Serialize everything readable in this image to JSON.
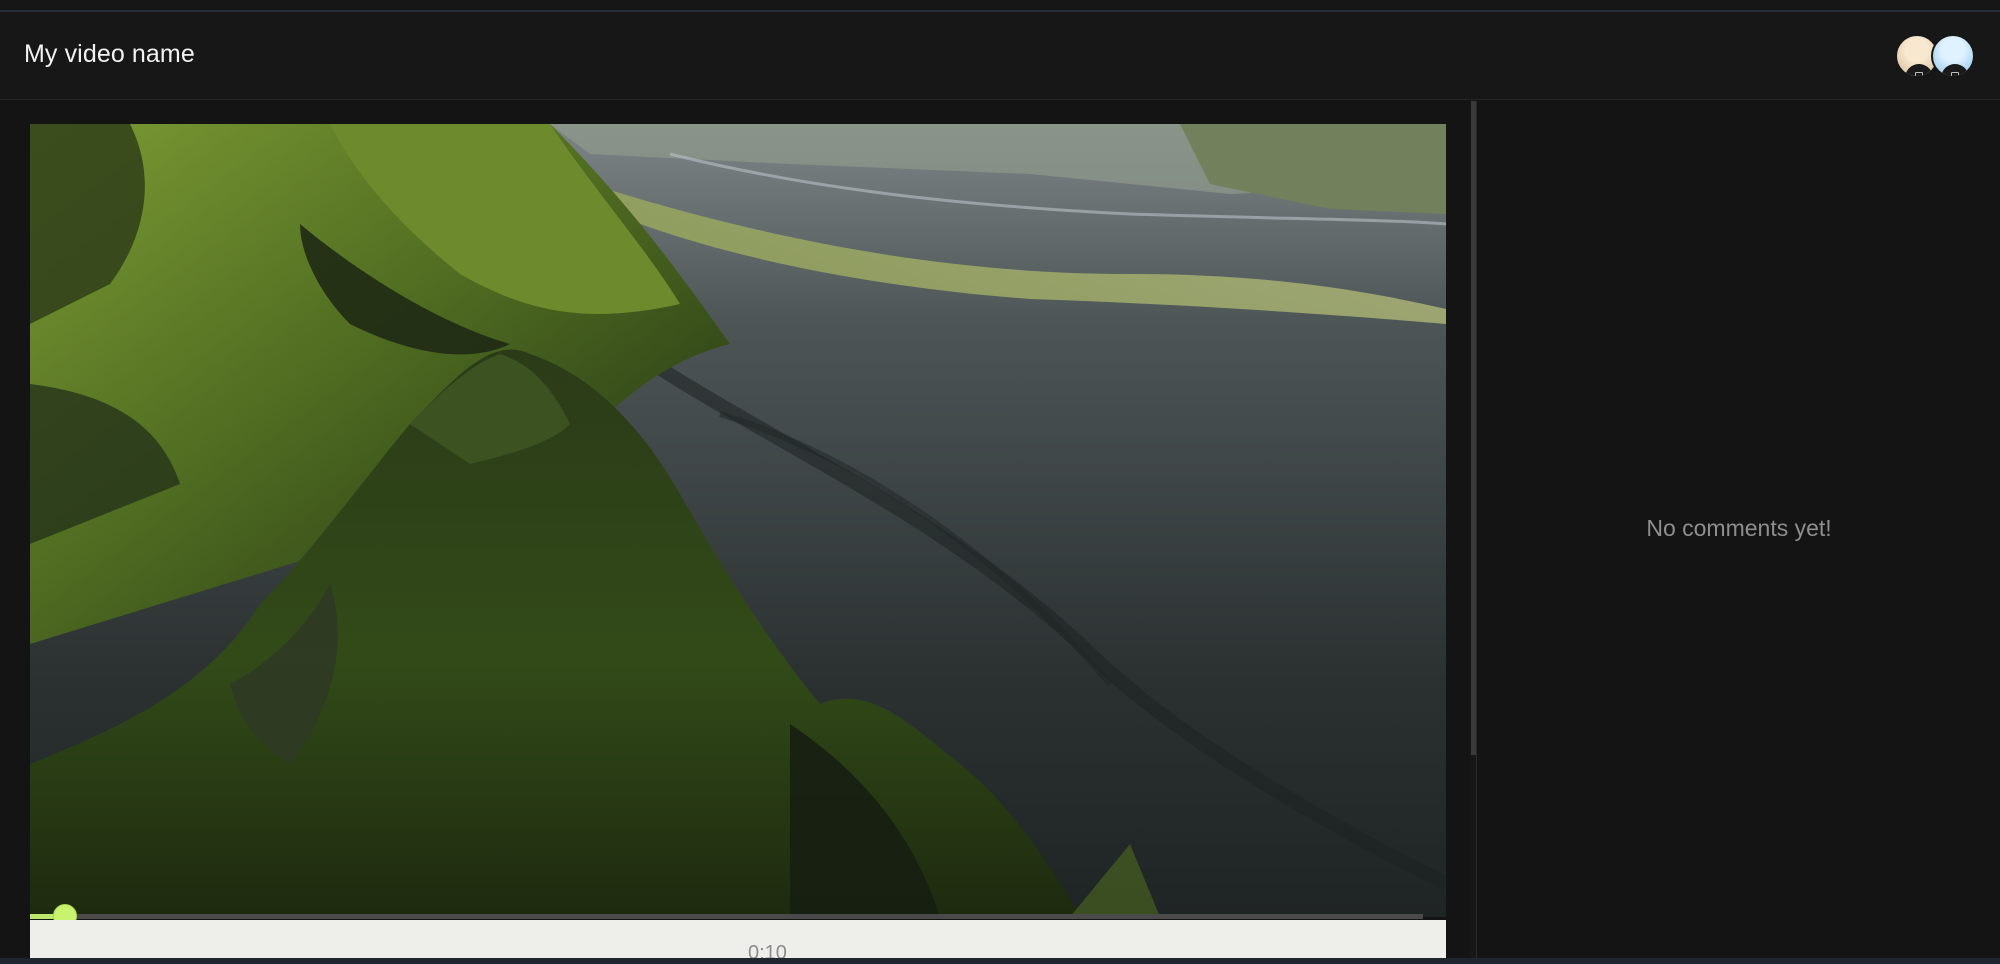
{
  "header": {
    "title": "My video name",
    "avatars": [
      {
        "name": "user-avatar-1",
        "color": "#e9d4b8"
      },
      {
        "name": "user-avatar-2",
        "color": "#b8dcf3"
      }
    ]
  },
  "player": {
    "current_time": "0:10",
    "progress": 0.025,
    "accent_color": "#c8f36e"
  },
  "comments": {
    "empty_text": "No comments yet!"
  }
}
